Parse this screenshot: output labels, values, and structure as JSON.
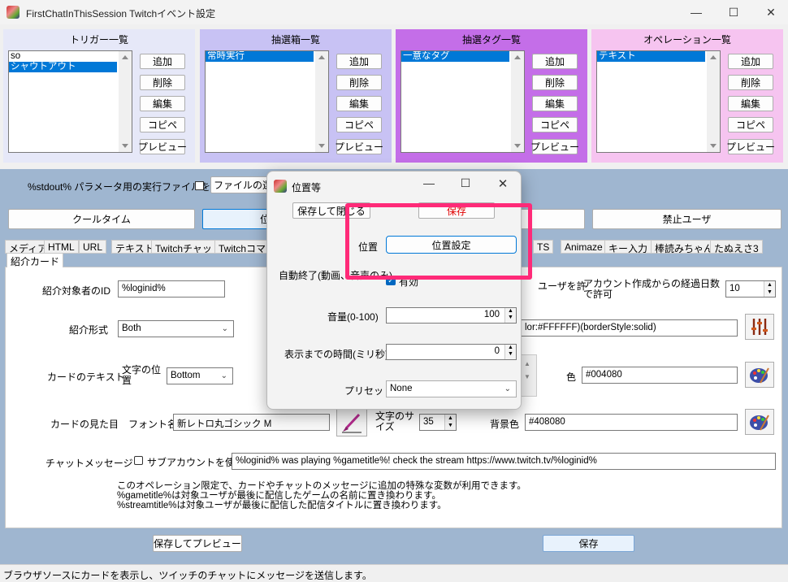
{
  "window": {
    "title": "FirstChatInThisSession Twitchイベント設定",
    "minimize": "—",
    "maximize": "☐",
    "close": "✕"
  },
  "panels": [
    {
      "title": "トリガー一覧",
      "bg": "#e6e8f8",
      "items": [
        "so",
        "シャウトアウト"
      ],
      "selected": 1
    },
    {
      "title": "抽選箱一覧",
      "bg": "#c8c2f4",
      "items": [
        "常時実行"
      ],
      "selected": 0
    },
    {
      "title": "抽選タグ一覧",
      "bg": "#c46ee8",
      "items": [
        "一意なタグ"
      ],
      "selected": 0
    },
    {
      "title": "オペレーション一覧",
      "bg": "#f6c4f0",
      "items": [
        "テキスト"
      ],
      "selected": 0
    }
  ],
  "panel_buttons": {
    "add": "追加",
    "delete": "削除",
    "edit": "編集",
    "copy": "コピペ",
    "preview": "プレビュー"
  },
  "stdout": {
    "label": "%stdout% パラメータ用の実行ファイルを使う",
    "file_button": "ファイルの選"
  },
  "buttons_row": {
    "cooltime": "クールタイム",
    "position": "位",
    "ban_user": "禁止ユーザ"
  },
  "tabs": [
    "メディア",
    "HTML",
    "URL",
    "テキスト",
    "Twitchチャット",
    "Twitchコマン",
    "TS",
    "Animaze",
    "キー入力",
    "棒読みちゃん",
    "たぬえさ3"
  ],
  "active_tab": "紹介カード",
  "form": {
    "target_id_label": "紹介対象者のID",
    "target_id_value": "%loginid%",
    "user_allow_label": "ユーザを許",
    "account_days_label": "アカウント作成からの経過日数で許可",
    "account_days_value": "10",
    "format_label": "紹介形式",
    "format_value": "Both",
    "style_value": "lor:#FFFFFF)(borderStyle:solid)",
    "card_text_label": "カードのテキスト",
    "text_pos_label": "文字の位置",
    "text_pos_value": "Bottom",
    "color_label": "色",
    "color_value": "#004080",
    "card_look_label": "カードの見た目",
    "font_label": "フォント名",
    "font_value": "新レトロ丸ゴシック M",
    "font_size_label": "文字のサイズ",
    "font_size_value": "35",
    "bg_color_label": "背景色",
    "bg_color_value": "#408080",
    "chat_label": "チャットメッセージ",
    "sub_account_label": "サブアカウントを使う",
    "chat_value": "%loginid% was playing %gametitle%! check the stream  https://www.twitch.tv/%loginid%",
    "note_lines": [
      "このオペレーション限定で、カードやチャットのメッセージに追加の特殊な変数が利用できます。",
      "%gametitle%は対象ユーザが最後に配信したゲームの名前に置き換わります。",
      "%streamtitle%は対象ユーザが最後に配信した配信タイトルに置き換わります。"
    ],
    "save_preview": "保存してプレビュー",
    "save": "保存"
  },
  "status": "ブラウザソースにカードを表示し、ツイッチのチャットにメッセージを送信します。",
  "dialog": {
    "title": "位置等",
    "save_close": "保存して閉じる",
    "save": "保存",
    "position_label": "位置",
    "position_button": "位置設定",
    "auto_end_label": "自動終了(動画、音声のみ)",
    "auto_end_check": "有効",
    "volume_label": "音量(0-100)",
    "volume_value": "100",
    "delay_label": "表示までの時間(ミリ秒)",
    "delay_value": "0",
    "preset_label": "プリセット",
    "preset_value": "None"
  },
  "colors": {
    "highlight": "#ff2a78",
    "selection": "#0078d7",
    "main_bg": "#9fb6d0"
  }
}
